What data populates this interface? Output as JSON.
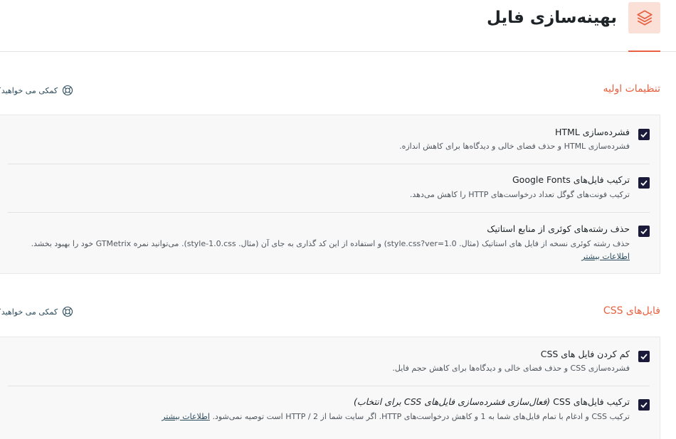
{
  "header": {
    "title": "بهینه‌سازی فایل",
    "icon": "layers-icon",
    "accent": "#e8603f",
    "icon_bg": "#fbe0d8"
  },
  "sections": [
    {
      "title": "تنظیمات اولیه",
      "help": "کمکی می خواهید؟",
      "options": [
        {
          "title": "فشرده‌سازی HTML",
          "desc": "فشرده‌سازی HTML و حذف فضای خالی و دیدگاه‌ها برای کاهش اندازه.",
          "checked": true
        },
        {
          "title": "ترکیب فایل‌های Google Fonts",
          "desc": "ترکیب فونت‌های گوگل تعداد درخواست‌های HTTP را کاهش می‌دهد.",
          "checked": true
        },
        {
          "title": "حذف رشته‌های کوئری از منابع استاتیک",
          "desc": "حذف رشته کوئری نسخه از فایل های استاتیک (مثال. style.css?ver=1.0) و استفاده از این کد گذاری به جای آن (مثال. style-1.0.css). می‌توانید نمره GTMetrix خود را بهبود بخشد.",
          "more": "اطلاعات بیشتر",
          "checked": true
        }
      ]
    },
    {
      "title": "فایل‌های CSS",
      "help": "کمکی می خواهید؟",
      "options": [
        {
          "title": "کم کردن فایل های CSS",
          "desc": "فشرده‌سازی CSS و حذف فضای خالی و دیدگاه‌ها برای کاهش حجم فایل.",
          "checked": true
        },
        {
          "title": "ترکیب فایل‌های CSS",
          "title_note": "(فعال‌سازی فشرده‌سازی فایل‌های CSS برای انتخاب)",
          "desc": "ترکیب CSS و ادغام با تمام فایل‌های شما به 1 و کاهش درخواست‌های HTTP. اگر سایت شما از HTTP / 2 است توصیه نمی‌شود.",
          "more": "اطلاعات بیشتر",
          "checked": true
        }
      ]
    }
  ]
}
